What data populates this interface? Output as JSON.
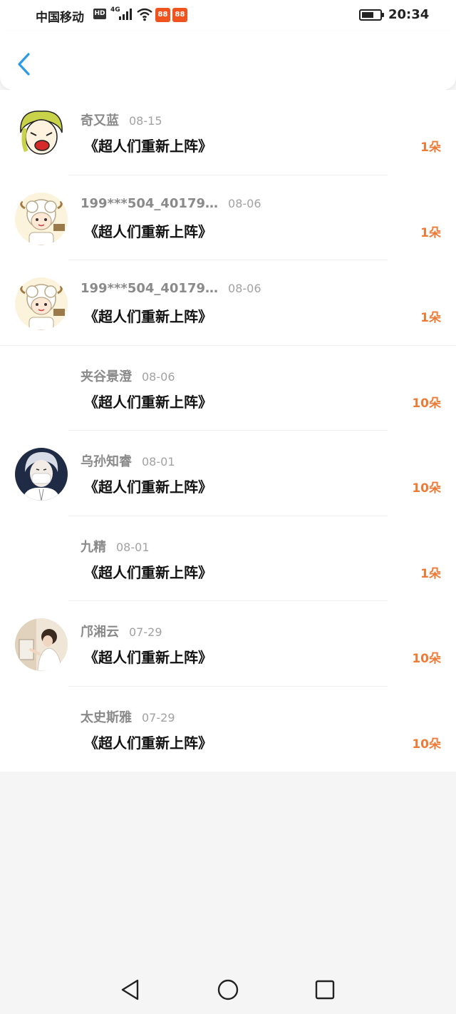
{
  "status_bar": {
    "carrier": "中国移动",
    "hd": "HD",
    "network": "4G",
    "app_badge_1": "88",
    "app_badge_2": "88",
    "time": "20:34"
  },
  "colors": {
    "accent_blue": "#2b9be8",
    "amount_orange": "#ed7b38"
  },
  "nav": {
    "back_icon": "chevron-left-icon"
  },
  "records": [
    {
      "name": "奇又蓝",
      "date": "08-15",
      "book": "《超人们重新上阵》",
      "amount": "1朵",
      "avatar": "blonde-girl"
    },
    {
      "name": "199***504_40179…",
      "date": "08-06",
      "book": "《超人们重新上阵》",
      "amount": "1朵",
      "avatar": "sheep"
    },
    {
      "name": "199***504_40179…",
      "date": "08-06",
      "book": "《超人们重新上阵》",
      "amount": "1朵",
      "avatar": "sheep"
    },
    {
      "name": "夹谷景澄",
      "date": "08-06",
      "book": "《超人们重新上阵》",
      "amount": "10朵",
      "avatar": ""
    },
    {
      "name": "乌孙知睿",
      "date": "08-01",
      "book": "《超人们重新上阵》",
      "amount": "10朵",
      "avatar": "masked-boy"
    },
    {
      "name": "九精",
      "date": "08-01",
      "book": "《超人们重新上阵》",
      "amount": "1朵",
      "avatar": ""
    },
    {
      "name": "邝湘云",
      "date": "07-29",
      "book": "《超人们重新上阵》",
      "amount": "10朵",
      "avatar": "painter"
    },
    {
      "name": "太史斯雅",
      "date": "07-29",
      "book": "《超人们重新上阵》",
      "amount": "10朵",
      "avatar": ""
    }
  ],
  "system_nav": {
    "back": "triangle-back-icon",
    "home": "circle-home-icon",
    "recents": "square-recents-icon"
  }
}
